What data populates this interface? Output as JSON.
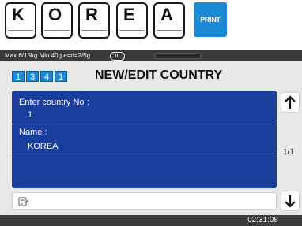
{
  "keys": [
    "K",
    "O",
    "R",
    "E",
    "A"
  ],
  "print_label": "PRINT",
  "status": {
    "text": "Max 6/15kg Min 40g e=d=2/5g",
    "class_badge": "III"
  },
  "codes": [
    "1",
    "3",
    "4",
    "1"
  ],
  "title": "NEW/EDIT COUNTRY",
  "fields": [
    {
      "label": "Enter country No :",
      "value": "1"
    },
    {
      "label": "Name :",
      "value": "KOREA"
    }
  ],
  "page_indicator": "1/1",
  "time": "02:31:08",
  "colors": {
    "accent": "#1a8ad6",
    "panel": "#1a3e9e",
    "bar": "#3a3a3a"
  }
}
